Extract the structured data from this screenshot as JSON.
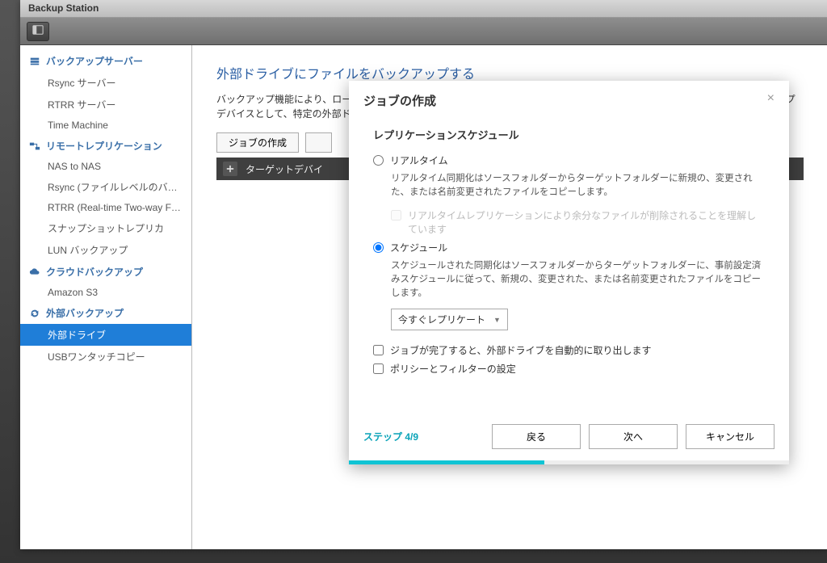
{
  "window": {
    "title": "Backup Station"
  },
  "sidebar": {
    "groups": [
      {
        "label": "バックアップサーバー",
        "items": [
          "Rsync サーバー",
          "RTRR サーバー",
          "Time Machine"
        ]
      },
      {
        "label": "リモートレプリケーション",
        "items": [
          "NAS to NAS",
          "Rsync (ファイルレベルのバック...",
          "RTRR (Real-time Two-way Folde...",
          "スナップショットレプリカ",
          "LUN バックアップ"
        ]
      },
      {
        "label": "クラウドバックアップ",
        "items": [
          "Amazon S3"
        ]
      },
      {
        "label": "外部バックアップ",
        "items": [
          "外部ドライブ",
          "USBワンタッチコピー"
        ]
      }
    ],
    "active": "外部ドライブ"
  },
  "main": {
    "heading": "外部ドライブにファイルをバックアップする",
    "desc": "バックアップ機能により、ローカルディスクから外部ストレージデバイスにファイルをバックアップできます。ジョブのバックアップデバイスとして、特定の外部ドライブが割り当てられた外部ストレージデバイスを使用できます。",
    "btn_create": "ジョブの作成",
    "grid_col": "ターゲットデバイ"
  },
  "modal": {
    "title": "ジョブの作成",
    "section": "レプリケーションスケジュール",
    "opt_realtime": "リアルタイム",
    "opt_realtime_desc": "リアルタイム同期化はソースフォルダーからターゲットフォルダーに新規の、変更された、または名前変更されたファイルをコピーします。",
    "opt_realtime_check": "リアルタイムレプリケーションにより余分なファイルが削除されることを理解しています",
    "opt_schedule": "スケジュール",
    "opt_schedule_desc": "スケジュールされた同期化はソースフォルダーからターゲットフォルダーに、事前設定済みスケジュールに従って、新規の、変更された、または名前変更されたファイルをコピーします。",
    "select_value": "今すぐレプリケート",
    "chk_eject": "ジョブが完了すると、外部ドライブを自動的に取り出します",
    "chk_policy": "ポリシーとフィルターの設定",
    "step": "ステップ 4/9",
    "step_current": 4,
    "step_total": 9,
    "btn_back": "戻る",
    "btn_next": "次へ",
    "btn_cancel": "キャンセル"
  }
}
